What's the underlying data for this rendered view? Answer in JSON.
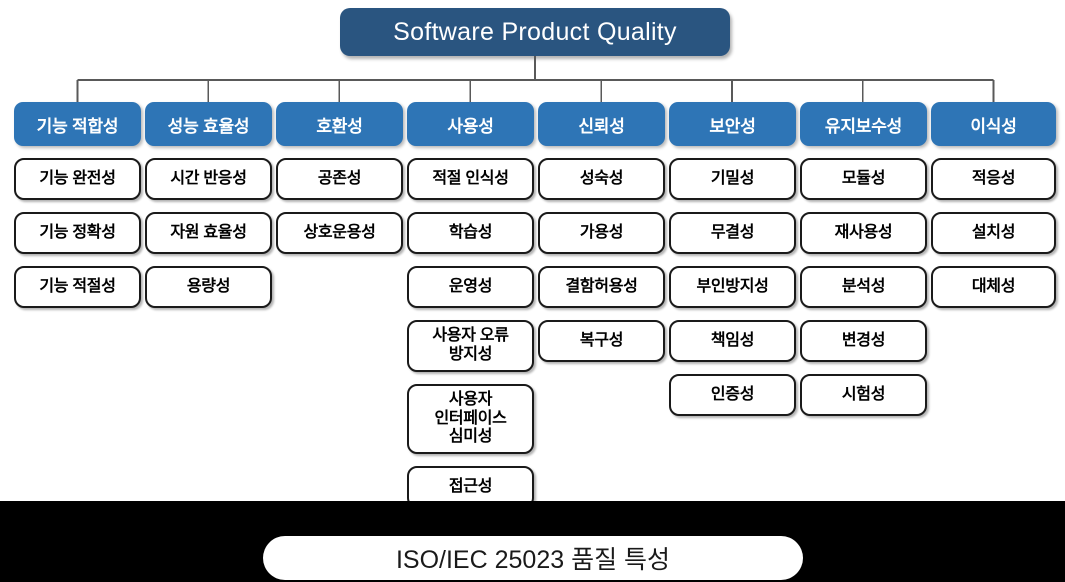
{
  "diagram": {
    "title": "Software Product Quality",
    "caption": "ISO/IEC 25023 품질 특성",
    "colors": {
      "title_box": "#2A5580",
      "category_box": "#2E75B6",
      "sub_box_border": "#1A1A1A",
      "sub_box_fill": "#FFFFFF",
      "connector_line": "#595959",
      "caption_band": "#000000",
      "caption_pill": "#FFFFFF"
    },
    "columns": [
      {
        "category": "기능 적합성",
        "items": [
          "기능 완전성",
          "기능 정확성",
          "기능 적절성"
        ]
      },
      {
        "category": "성능 효율성",
        "items": [
          "시간 반응성",
          "자원 효율성",
          "용량성"
        ]
      },
      {
        "category": "호환성",
        "items": [
          "공존성",
          "상호운용성"
        ]
      },
      {
        "category": "사용성",
        "items": [
          "적절 인식성",
          "학습성",
          "운영성",
          "사용자 오류\n방지성",
          "사용자\n인터페이스\n심미성",
          "접근성"
        ]
      },
      {
        "category": "신뢰성",
        "items": [
          "성숙성",
          "가용성",
          "결함허용성",
          "복구성"
        ]
      },
      {
        "category": "보안성",
        "items": [
          "기밀성",
          "무결성",
          "부인방지성",
          "책임성",
          "인증성"
        ]
      },
      {
        "category": "유지보수성",
        "items": [
          "모듈성",
          "재사용성",
          "분석성",
          "변경성",
          "시험성"
        ]
      },
      {
        "category": "이식성",
        "items": [
          "적응성",
          "설치성",
          "대체성"
        ]
      }
    ]
  }
}
